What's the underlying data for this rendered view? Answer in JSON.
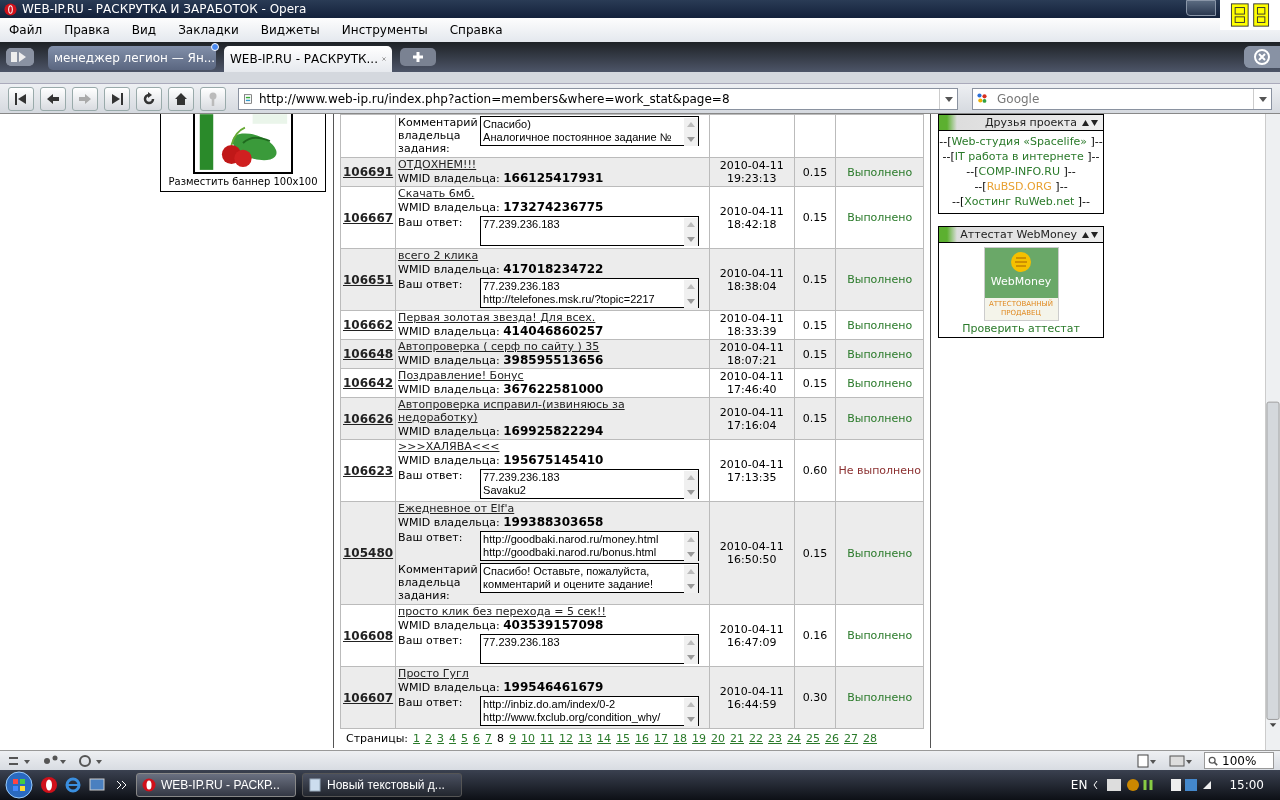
{
  "window": {
    "title": "WEB-IP.RU - РАСКРУТКА И ЗАРАБОТОК - Opera"
  },
  "menu": [
    "Файл",
    "Правка",
    "Вид",
    "Закладки",
    "Виджеты",
    "Инструменты",
    "Справка"
  ],
  "tabs": [
    {
      "label": "менеджер легион — Ян...",
      "selected": false,
      "updated": true
    },
    {
      "label": "WEB-IP.RU - РАСКРУТК...",
      "selected": true,
      "updated": false
    }
  ],
  "address": {
    "url": "http://www.web-ip.ru/index.php?action=members&where=work_stat&page=8"
  },
  "search": {
    "placeholder": "Google"
  },
  "banner": {
    "caption": "Разместить баннер 100x100"
  },
  "rows": [
    {
      "comment_label": "Комментарий владельца задания:",
      "comment": [
        "Спасибо)",
        "Аналогичное постоянное задание №"
      ]
    },
    {
      "id": "106691",
      "title": "ОТДОХНЕМ!!!",
      "wmid_label": "WMID владельца:",
      "wmid": "166125417931",
      "date": "2010-04-11",
      "time": "19:23:13",
      "price": "0.15",
      "status": "Выполнено",
      "done": true
    },
    {
      "id": "106667",
      "title": "Скачать 6мб.",
      "wmid_label": "WMID владельца:",
      "wmid": "173274236775",
      "answer_label": "Ваш ответ:",
      "answer": [
        "77.239.236.183"
      ],
      "date": "2010-04-11",
      "time": "18:42:18",
      "price": "0.15",
      "status": "Выполнено",
      "done": true
    },
    {
      "id": "106651",
      "title": "всего 2 клика",
      "wmid_label": "WMID владельца:",
      "wmid": "417018234722",
      "answer_label": "Ваш ответ:",
      "answer": [
        "77.239.236.183",
        "http://telefones.msk.ru/?topic=2217"
      ],
      "date": "2010-04-11",
      "time": "18:38:04",
      "price": "0.15",
      "status": "Выполнено",
      "done": true
    },
    {
      "id": "106662",
      "title": "Первая золотая звезда! Для всех.",
      "wmid_label": "WMID владельца:",
      "wmid": "414046860257",
      "date": "2010-04-11",
      "time": "18:33:39",
      "price": "0.15",
      "status": "Выполнено",
      "done": true
    },
    {
      "id": "106648",
      "title": "Автопроверка ( серф по сайту ) 35",
      "wmid_label": "WMID владельца:",
      "wmid": "398595513656",
      "date": "2010-04-11",
      "time": "18:07:21",
      "price": "0.15",
      "status": "Выполнено",
      "done": true
    },
    {
      "id": "106642",
      "title": "Поздравление! Бонус",
      "wmid_label": "WMID владельца:",
      "wmid": "367622581000",
      "date": "2010-04-11",
      "time": "17:46:40",
      "price": "0.15",
      "status": "Выполнено",
      "done": true
    },
    {
      "id": "106626",
      "title": "Автопроверка исправил-(извиняюсь за недоработку)",
      "wmid_label": "WMID владельца:",
      "wmid": "169925822294",
      "date": "2010-04-11",
      "time": "17:16:04",
      "price": "0.15",
      "status": "Выполнено",
      "done": true
    },
    {
      "id": "106623",
      "title": ">>>ХАЛЯВА<<<",
      "wmid_label": "WMID владельца:",
      "wmid": "195675145410",
      "answer_label": "Ваш ответ:",
      "answer": [
        "77.239.236.183",
        "Savaku2"
      ],
      "date": "2010-04-11",
      "time": "17:13:35",
      "price": "0.60",
      "status": "Не выполнено",
      "done": false
    },
    {
      "id": "105480",
      "title": "Ежедневное от Elf'a",
      "wmid_label": "WMID владельца:",
      "wmid": "199388303658",
      "answer_label": "Ваш ответ:",
      "answer": [
        "http://goodbaki.narod.ru/money.html",
        "http://goodbaki.narod.ru/bonus.html"
      ],
      "comment_label": "Комментарий владельца задания:",
      "comment": [
        "Спасибо! Оставьте, пожалуйста,",
        "комментарий и оцените задание!"
      ],
      "date": "2010-04-11",
      "time": "16:50:50",
      "price": "0.15",
      "status": "Выполнено",
      "done": true
    },
    {
      "id": "106608",
      "title": "просто клик без перехода = 5 сек!!",
      "wmid_label": "WMID владельца:",
      "wmid": "403539157098",
      "answer_label": "Ваш ответ:",
      "answer": [
        "77.239.236.183"
      ],
      "date": "2010-04-11",
      "time": "16:47:09",
      "price": "0.16",
      "status": "Выполнено",
      "done": true
    },
    {
      "id": "106607",
      "title": "Просто Гугл",
      "wmid_label": "WMID владельца:",
      "wmid": "199546461679",
      "answer_label": "Ваш ответ:",
      "answer": [
        "http://inbiz.do.am/index/0-2",
        "http://www.fxclub.org/condition_why/"
      ],
      "date": "2010-04-11",
      "time": "16:44:59",
      "price": "0.30",
      "status": "Выполнено",
      "done": true
    }
  ],
  "pages": {
    "label": "Страницы:",
    "items": [
      {
        "label": "1",
        "selected": false
      },
      {
        "label": "2",
        "selected": false
      },
      {
        "label": "3",
        "selected": false
      },
      {
        "label": "4",
        "selected": false
      },
      {
        "label": "5",
        "selected": false
      },
      {
        "label": "6",
        "selected": false
      },
      {
        "label": "7",
        "selected": false
      },
      {
        "label": "8",
        "selected": true
      },
      {
        "label": "9",
        "selected": false
      },
      {
        "label": "10",
        "selected": false
      },
      {
        "label": "11",
        "selected": false
      },
      {
        "label": "12",
        "selected": false
      },
      {
        "label": "13",
        "selected": false
      },
      {
        "label": "14",
        "selected": false
      },
      {
        "label": "15",
        "selected": false
      },
      {
        "label": "16",
        "selected": false
      },
      {
        "label": "17",
        "selected": false
      },
      {
        "label": "18",
        "selected": false
      },
      {
        "label": "19",
        "selected": false
      },
      {
        "label": "20",
        "selected": false
      },
      {
        "label": "21",
        "selected": false
      },
      {
        "label": "22",
        "selected": false
      },
      {
        "label": "23",
        "selected": false
      },
      {
        "label": "24",
        "selected": false
      },
      {
        "label": "25",
        "selected": false
      },
      {
        "label": "26",
        "selected": false
      },
      {
        "label": "27",
        "selected": false
      },
      {
        "label": "28",
        "selected": false
      }
    ]
  },
  "friends": {
    "title": "Друзья проекта",
    "links": [
      {
        "prefix": "--[",
        "text": "Web-студия «Spacelife»",
        "suffix": "]--",
        "color": "#2a7a2a"
      },
      {
        "prefix": "--[",
        "text": "IT работа в интернете",
        "suffix": "]--",
        "color": "#2a7a2a"
      },
      {
        "prefix": "--[",
        "text": "COMP-INFO.RU",
        "suffix": "]--",
        "color": "#2a7a2a"
      },
      {
        "prefix": "--[",
        "text": "RuBSD.ORG",
        "suffix": "]--",
        "color": "#e8a030"
      },
      {
        "prefix": "--[",
        "text": "Хостинг RuWeb.net",
        "suffix": "]--",
        "color": "#2a7a2a"
      }
    ]
  },
  "attestat": {
    "title": "Аттестат WebMoney",
    "brand": "WebMoney",
    "badge_caption": "АТТЕСТОВАННЫЙ ПРОДАВЕЦ",
    "link": "Проверить аттестат"
  },
  "status_bar": {
    "zoom": "100%"
  },
  "taskbar": {
    "items": [
      {
        "label": "WEB-IP.RU - РАСКР...",
        "selected": true
      },
      {
        "label": "Новый текстовый д...",
        "selected": false
      }
    ],
    "language": "EN",
    "clock": "15:00"
  }
}
